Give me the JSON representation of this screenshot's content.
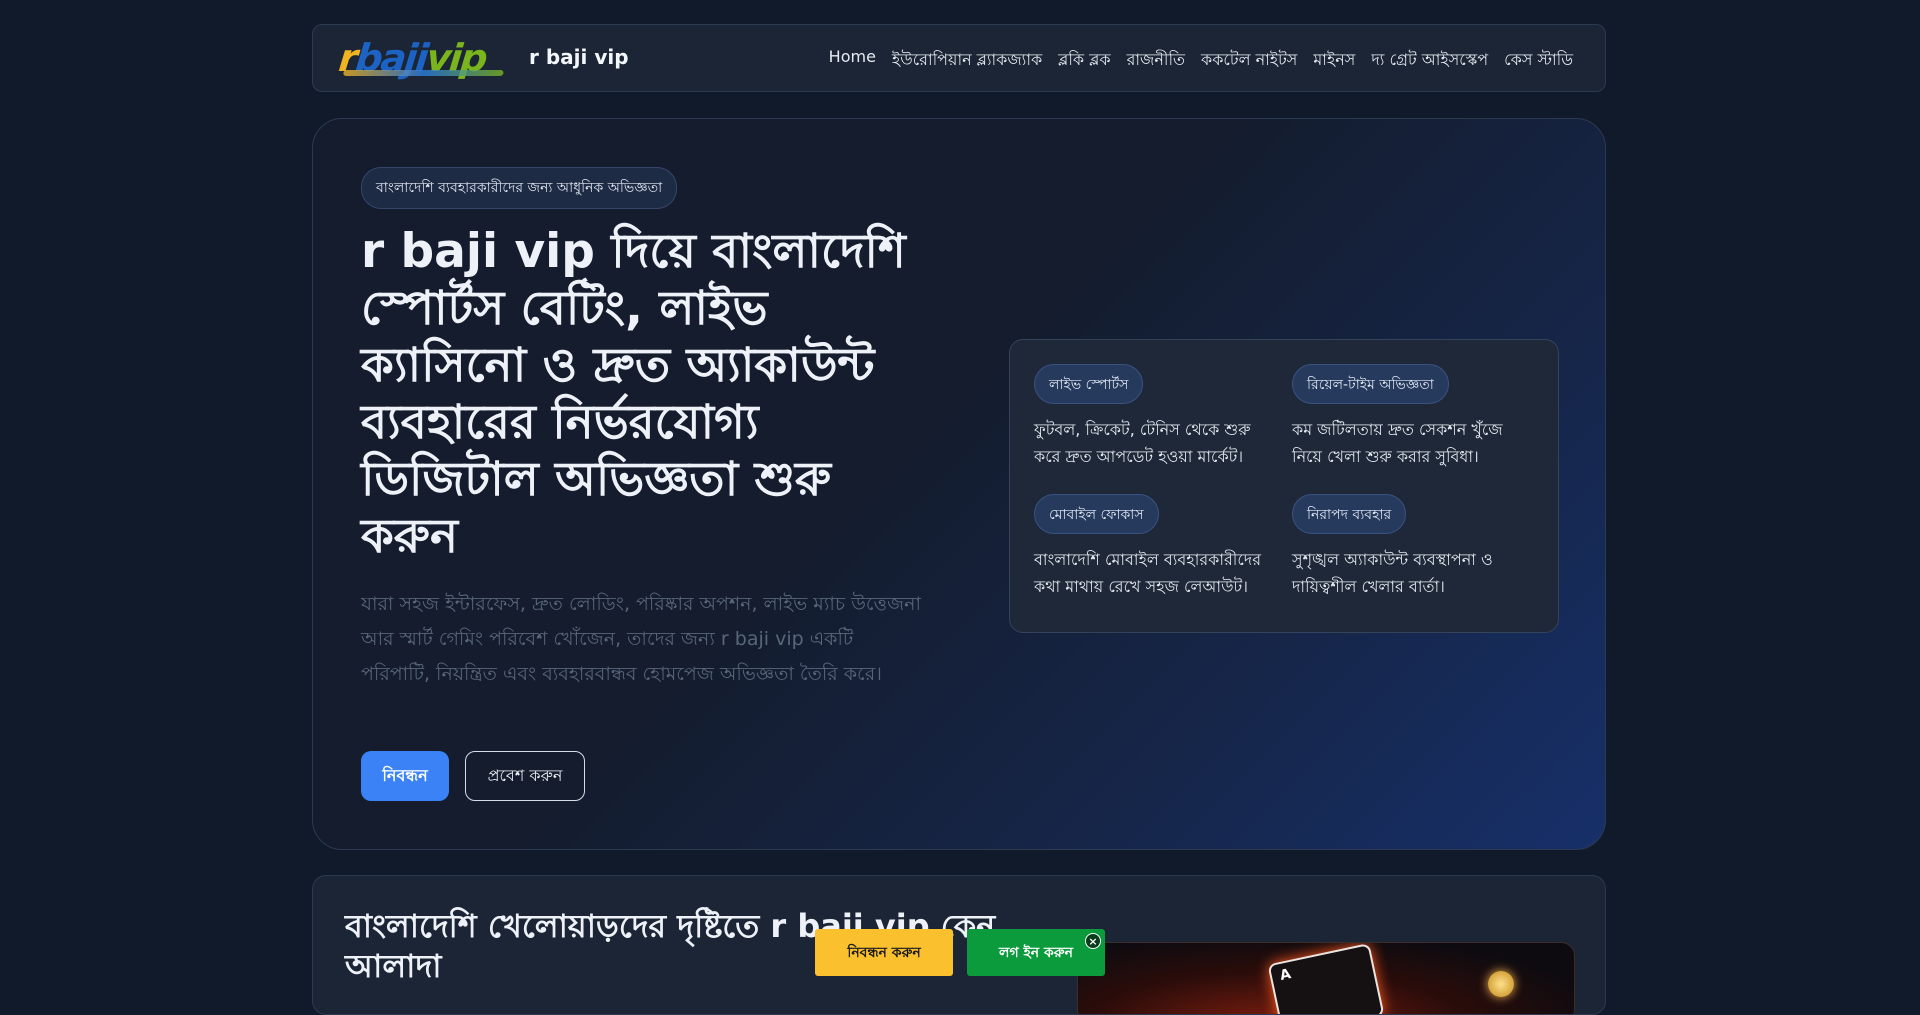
{
  "header": {
    "logo": {
      "r": "r",
      "baji": "baji",
      "vip": "vip"
    },
    "brand": "r baji vip",
    "nav": [
      "Home",
      "ইউরোপিয়ান ব্ল্যাকজ্যাক",
      "ব্লকি ব্লক",
      "রাজনীতি",
      "ককটেল নাইটস",
      "মাইনস",
      "দ্য গ্রেট আইসস্কেপ",
      "কেস স্টাডি"
    ]
  },
  "hero": {
    "badge": "বাংলাদেশি ব্যবহারকারীদের জন্য আধুনিক অভিজ্ঞতা",
    "title": "r baji vip দিয়ে বাংলাদেশি স্পোর্টস বেটিং, লাইভ ক্যাসিনো ও দ্রুত অ্যাকাউন্ট ব্যবহারের নির্ভরযোগ্য ডিজিটাল অভিজ্ঞতা শুরু করুন",
    "description": "যারা সহজ ইন্টারফেস, দ্রুত লোডিং, পরিষ্কার অপশন, লাইভ ম্যাচ উত্তেজনা আর স্মার্ট গেমিং পরিবেশ খোঁজেন, তাদের জন্য r baji vip একটি পরিপাটি, নিয়ন্ত্রিত এবং ব্যবহারবান্ধব হোমপেজ অভিজ্ঞতা তৈরি করে।",
    "primary_button": "নিবন্ধন",
    "secondary_button": "প্রবেশ করুন",
    "features": [
      {
        "tag": "লাইভ স্পোর্টস",
        "text": "ফুটবল, ক্রিকেট, টেনিস থেকে শুরু করে দ্রুত আপডেট হওয়া মার্কেট।"
      },
      {
        "tag": "রিয়েল-টাইম অভিজ্ঞতা",
        "text": "কম জটিলতায় দ্রুত সেকশন খুঁজে নিয়ে খেলা শুরু করার সুবিধা।"
      },
      {
        "tag": "মোবাইল ফোকাস",
        "text": "বাংলাদেশি মোবাইল ব্যবহারকারীদের কথা মাথায় রেখে সহজ লেআউট।"
      },
      {
        "tag": "নিরাপদ ব্যবহার",
        "text": "সুশৃঙ্খল অ্যাকাউন্ট ব্যবস্থাপনা ও দায়িত্বশীল খেলার বার্তা।"
      }
    ]
  },
  "section2": {
    "title": "বাংলাদেশি খেলোয়াড়দের দৃষ্টিতে r baji vip কেন আলাদা",
    "image_card_letter": "A"
  },
  "floating": {
    "register": "নিবন্ধন করুন",
    "login": "লগ ইন করুন",
    "close": "×"
  }
}
